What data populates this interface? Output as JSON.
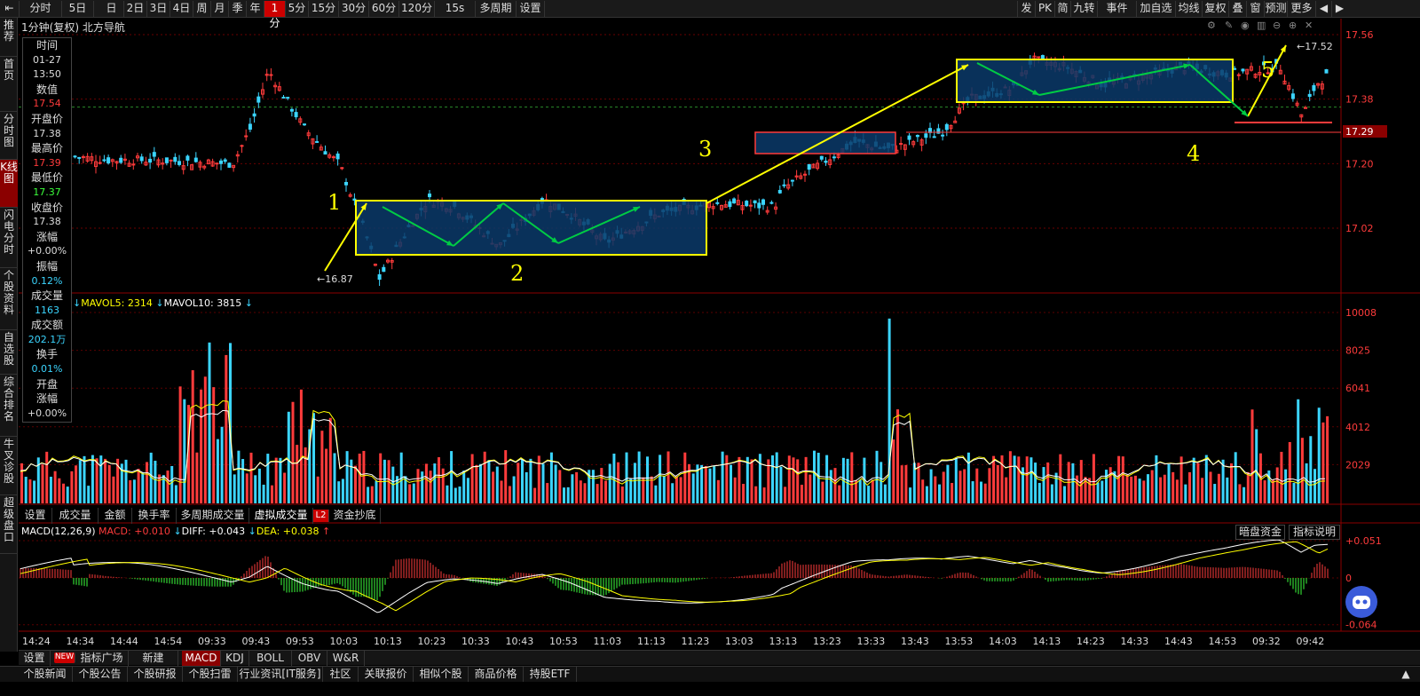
{
  "toolbar": {
    "periods": [
      "分时",
      "5日",
      "日",
      "2日",
      "3日",
      "4日",
      "周",
      "月",
      "季",
      "年",
      "1分",
      "5分",
      "15分",
      "30分",
      "60分",
      "120分",
      "15s",
      "多周期",
      "设置"
    ],
    "active_period": "1分",
    "right_buttons": [
      "发",
      "PK",
      "简",
      "九转",
      "事件",
      "加自选",
      "均线",
      "复权",
      "叠",
      "窗",
      "预测",
      "更多"
    ]
  },
  "left_nav": [
    "推荐",
    "首页",
    "分时图",
    "K线图",
    "闪电分时",
    "个股资料",
    "自选股",
    "综合排名",
    "牛叉诊股",
    "超级盘口"
  ],
  "title": "1分钟(复权)  北方导航",
  "info_panel": [
    {
      "label": "时间",
      "value": "01-27",
      "value2": "13:50",
      "color": "#ddd"
    },
    {
      "label": "数值",
      "value": "17.54",
      "color": "#ff3b3b"
    },
    {
      "label": "开盘价",
      "value": "17.38",
      "color": "#ddd"
    },
    {
      "label": "最高价",
      "value": "17.39",
      "color": "#ff3b3b"
    },
    {
      "label": "最低价",
      "value": "17.37",
      "color": "#3bff3b"
    },
    {
      "label": "收盘价",
      "value": "17.38",
      "color": "#ddd"
    },
    {
      "label": "涨幅",
      "value": "+0.00%",
      "color": "#ddd"
    },
    {
      "label": "振幅",
      "value": "0.12%",
      "color": "#3bd5ff"
    },
    {
      "label": "成交量",
      "value": "1163",
      "color": "#3bd5ff"
    },
    {
      "label": "成交额",
      "value": "202.1万",
      "color": "#3bd5ff"
    },
    {
      "label": "换手",
      "value": "0.01%",
      "color": "#3bd5ff"
    },
    {
      "label": "开盘",
      "value": "",
      "color": "#ddd"
    },
    {
      "label": "涨幅",
      "value": "+0.00%",
      "color": "#ddd"
    }
  ],
  "price_axis": [
    "17.56",
    "17.38",
    "17.20",
    "17.02"
  ],
  "current_price": "17.29",
  "high_label": "17.52",
  "low_label": "16.87",
  "annotations": [
    "1",
    "2",
    "3",
    "4",
    "5"
  ],
  "volume": {
    "legend_mavol5": "MAVOL5: 2314",
    "legend_mavol10": "MAVOL10: 3815",
    "axis": [
      "10008",
      "8025",
      "6041",
      "4012",
      "2029"
    ]
  },
  "indicator_tabs": [
    "设置",
    "成交量",
    "金额",
    "换手率",
    "多周期成交量",
    "虚拟成交量",
    "资金抄底"
  ],
  "macd": {
    "name": "MACD(12,26,9)",
    "macd": "MACD: +0.010",
    "diff": "DIFF: +0.043",
    "dea": "DEA: +0.038",
    "axis": [
      "+0.051",
      "0",
      "-0.064"
    ],
    "buttons": [
      "暗盘资金",
      "指标说明"
    ]
  },
  "time_axis": [
    "14:24",
    "14:34",
    "14:44",
    "14:54",
    "09:33",
    "09:43",
    "09:53",
    "10:03",
    "10:13",
    "10:23",
    "10:33",
    "10:43",
    "10:53",
    "11:03",
    "11:13",
    "11:23",
    "13:03",
    "13:13",
    "13:23",
    "13:33",
    "13:43",
    "13:53",
    "14:03",
    "14:13",
    "14:23",
    "14:33",
    "14:43",
    "14:53",
    "09:32",
    "09:42"
  ],
  "bottom_tabs": [
    "设置",
    "NEW",
    "指标广场",
    "新建",
    "MACD",
    "KDJ",
    "BOLL",
    "OBV",
    "W&R"
  ],
  "news_tabs": [
    "个股新闻",
    "个股公告",
    "个股研报",
    "个股扫雷",
    "行业资讯[IT服务]",
    "社区",
    "关联报价",
    "相似个股",
    "商品价格",
    "持股ETF"
  ],
  "colors": {
    "up": "#ff3b3b",
    "down": "#3bd5ff",
    "box": "#ffff00",
    "arrow": "#00cc44",
    "consolidation": "#0a3a6a"
  }
}
